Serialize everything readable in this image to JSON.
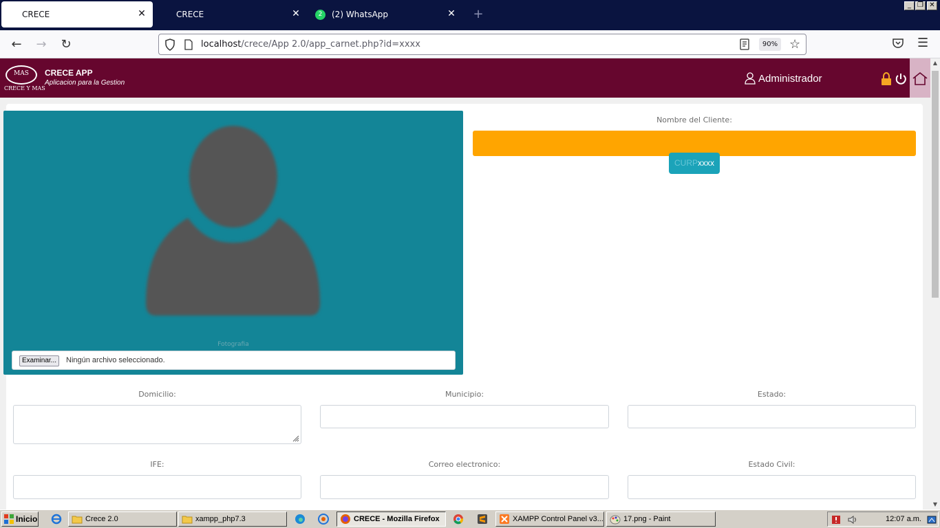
{
  "browser": {
    "tabs": [
      {
        "label": "CRECE",
        "active": true
      },
      {
        "label": "CRECE",
        "active": false
      },
      {
        "label": "(2) WhatsApp",
        "active": false,
        "badge": "2"
      }
    ],
    "url_host": "localhost",
    "url_path": "/crece/App 2.0/app_carnet.php?id=xxxx",
    "zoom": "90%",
    "icons": [
      "back-icon",
      "forward-icon",
      "reload-icon",
      "shield-icon",
      "page-icon",
      "reader-icon",
      "star-icon",
      "pocket-icon",
      "menu-icon"
    ]
  },
  "app": {
    "title": "CRECE APP",
    "subtitle": "Aplicacion para la Gestion",
    "logo_text": "CRECE Y MAS",
    "logo_mas": "MAS",
    "user": "Administrador",
    "brand_color": "#66062e"
  },
  "form": {
    "photo_label": "Fotografia",
    "file_button": "Examinar...",
    "file_status": "Ningún archivo seleccionado.",
    "nombre_label": "Nombre del Cliente:",
    "nombre_value": "",
    "curp_key": "CURP",
    "curp_value": "xxxx",
    "domicilio_label": "Domicilio:",
    "municipio_label": "Municipio:",
    "estado_label": "Estado:",
    "ife_label": "IFE:",
    "correo_label": "Correo electronico:",
    "estado_civil_label": "Estado Civil:",
    "accent_orange": "#ffa500",
    "accent_teal": "#138597"
  },
  "taskbar": {
    "start": "Inicio",
    "items": [
      {
        "label": "Crece 2.0"
      },
      {
        "label": "xampp_php7.3"
      },
      {
        "label": "CRECE - Mozilla Firefox"
      },
      {
        "label": "XAMPP Control Panel v3...."
      },
      {
        "label": "17.png - Paint"
      }
    ],
    "clock": "12:07 a.m."
  }
}
